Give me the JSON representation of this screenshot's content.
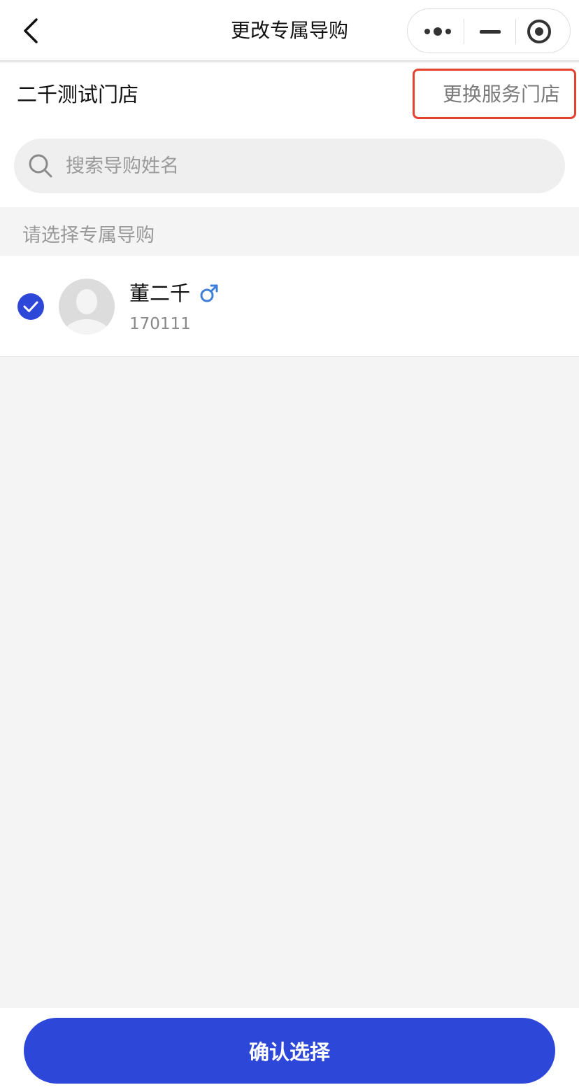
{
  "nav": {
    "title": "更改专属导购"
  },
  "store": {
    "name": "二千测试门店",
    "change_label": "更换服务门店"
  },
  "search": {
    "placeholder": "搜索导购姓名",
    "value": ""
  },
  "list": {
    "section_title": "请选择专属导购",
    "items": [
      {
        "name": "董二千",
        "id": "170111",
        "gender": "male",
        "selected": true
      }
    ]
  },
  "footer": {
    "confirm_label": "确认选择"
  },
  "colors": {
    "accent": "#2d47d9",
    "highlight_border": "#e5412f",
    "gender_male": "#3f7fd8"
  }
}
